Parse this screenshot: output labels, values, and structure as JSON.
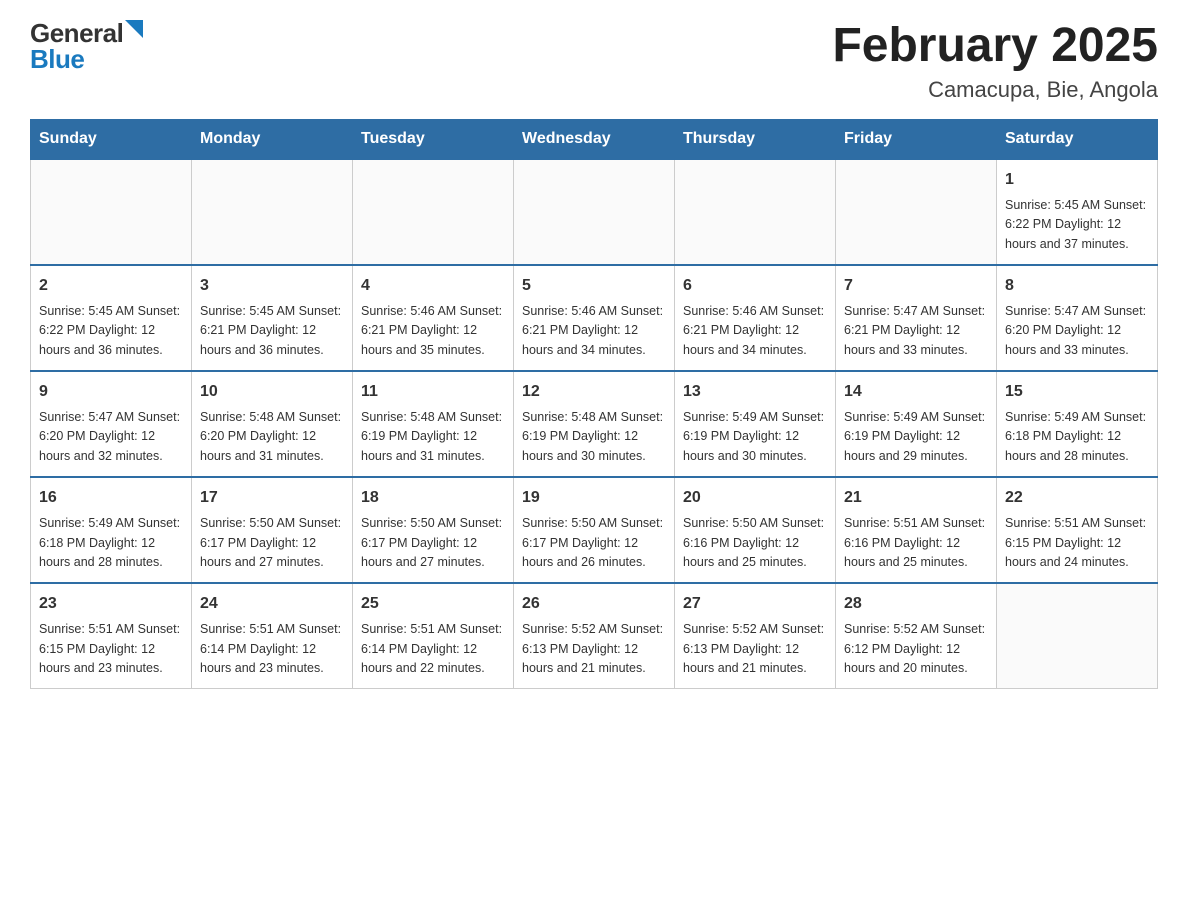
{
  "header": {
    "logo_general": "General",
    "logo_blue": "Blue",
    "title": "February 2025",
    "subtitle": "Camacupa, Bie, Angola"
  },
  "days_of_week": [
    "Sunday",
    "Monday",
    "Tuesday",
    "Wednesday",
    "Thursday",
    "Friday",
    "Saturday"
  ],
  "weeks": [
    [
      {
        "day": "",
        "info": ""
      },
      {
        "day": "",
        "info": ""
      },
      {
        "day": "",
        "info": ""
      },
      {
        "day": "",
        "info": ""
      },
      {
        "day": "",
        "info": ""
      },
      {
        "day": "",
        "info": ""
      },
      {
        "day": "1",
        "info": "Sunrise: 5:45 AM\nSunset: 6:22 PM\nDaylight: 12 hours and 37 minutes."
      }
    ],
    [
      {
        "day": "2",
        "info": "Sunrise: 5:45 AM\nSunset: 6:22 PM\nDaylight: 12 hours and 36 minutes."
      },
      {
        "day": "3",
        "info": "Sunrise: 5:45 AM\nSunset: 6:21 PM\nDaylight: 12 hours and 36 minutes."
      },
      {
        "day": "4",
        "info": "Sunrise: 5:46 AM\nSunset: 6:21 PM\nDaylight: 12 hours and 35 minutes."
      },
      {
        "day": "5",
        "info": "Sunrise: 5:46 AM\nSunset: 6:21 PM\nDaylight: 12 hours and 34 minutes."
      },
      {
        "day": "6",
        "info": "Sunrise: 5:46 AM\nSunset: 6:21 PM\nDaylight: 12 hours and 34 minutes."
      },
      {
        "day": "7",
        "info": "Sunrise: 5:47 AM\nSunset: 6:21 PM\nDaylight: 12 hours and 33 minutes."
      },
      {
        "day": "8",
        "info": "Sunrise: 5:47 AM\nSunset: 6:20 PM\nDaylight: 12 hours and 33 minutes."
      }
    ],
    [
      {
        "day": "9",
        "info": "Sunrise: 5:47 AM\nSunset: 6:20 PM\nDaylight: 12 hours and 32 minutes."
      },
      {
        "day": "10",
        "info": "Sunrise: 5:48 AM\nSunset: 6:20 PM\nDaylight: 12 hours and 31 minutes."
      },
      {
        "day": "11",
        "info": "Sunrise: 5:48 AM\nSunset: 6:19 PM\nDaylight: 12 hours and 31 minutes."
      },
      {
        "day": "12",
        "info": "Sunrise: 5:48 AM\nSunset: 6:19 PM\nDaylight: 12 hours and 30 minutes."
      },
      {
        "day": "13",
        "info": "Sunrise: 5:49 AM\nSunset: 6:19 PM\nDaylight: 12 hours and 30 minutes."
      },
      {
        "day": "14",
        "info": "Sunrise: 5:49 AM\nSunset: 6:19 PM\nDaylight: 12 hours and 29 minutes."
      },
      {
        "day": "15",
        "info": "Sunrise: 5:49 AM\nSunset: 6:18 PM\nDaylight: 12 hours and 28 minutes."
      }
    ],
    [
      {
        "day": "16",
        "info": "Sunrise: 5:49 AM\nSunset: 6:18 PM\nDaylight: 12 hours and 28 minutes."
      },
      {
        "day": "17",
        "info": "Sunrise: 5:50 AM\nSunset: 6:17 PM\nDaylight: 12 hours and 27 minutes."
      },
      {
        "day": "18",
        "info": "Sunrise: 5:50 AM\nSunset: 6:17 PM\nDaylight: 12 hours and 27 minutes."
      },
      {
        "day": "19",
        "info": "Sunrise: 5:50 AM\nSunset: 6:17 PM\nDaylight: 12 hours and 26 minutes."
      },
      {
        "day": "20",
        "info": "Sunrise: 5:50 AM\nSunset: 6:16 PM\nDaylight: 12 hours and 25 minutes."
      },
      {
        "day": "21",
        "info": "Sunrise: 5:51 AM\nSunset: 6:16 PM\nDaylight: 12 hours and 25 minutes."
      },
      {
        "day": "22",
        "info": "Sunrise: 5:51 AM\nSunset: 6:15 PM\nDaylight: 12 hours and 24 minutes."
      }
    ],
    [
      {
        "day": "23",
        "info": "Sunrise: 5:51 AM\nSunset: 6:15 PM\nDaylight: 12 hours and 23 minutes."
      },
      {
        "day": "24",
        "info": "Sunrise: 5:51 AM\nSunset: 6:14 PM\nDaylight: 12 hours and 23 minutes."
      },
      {
        "day": "25",
        "info": "Sunrise: 5:51 AM\nSunset: 6:14 PM\nDaylight: 12 hours and 22 minutes."
      },
      {
        "day": "26",
        "info": "Sunrise: 5:52 AM\nSunset: 6:13 PM\nDaylight: 12 hours and 21 minutes."
      },
      {
        "day": "27",
        "info": "Sunrise: 5:52 AM\nSunset: 6:13 PM\nDaylight: 12 hours and 21 minutes."
      },
      {
        "day": "28",
        "info": "Sunrise: 5:52 AM\nSunset: 6:12 PM\nDaylight: 12 hours and 20 minutes."
      },
      {
        "day": "",
        "info": ""
      }
    ]
  ]
}
